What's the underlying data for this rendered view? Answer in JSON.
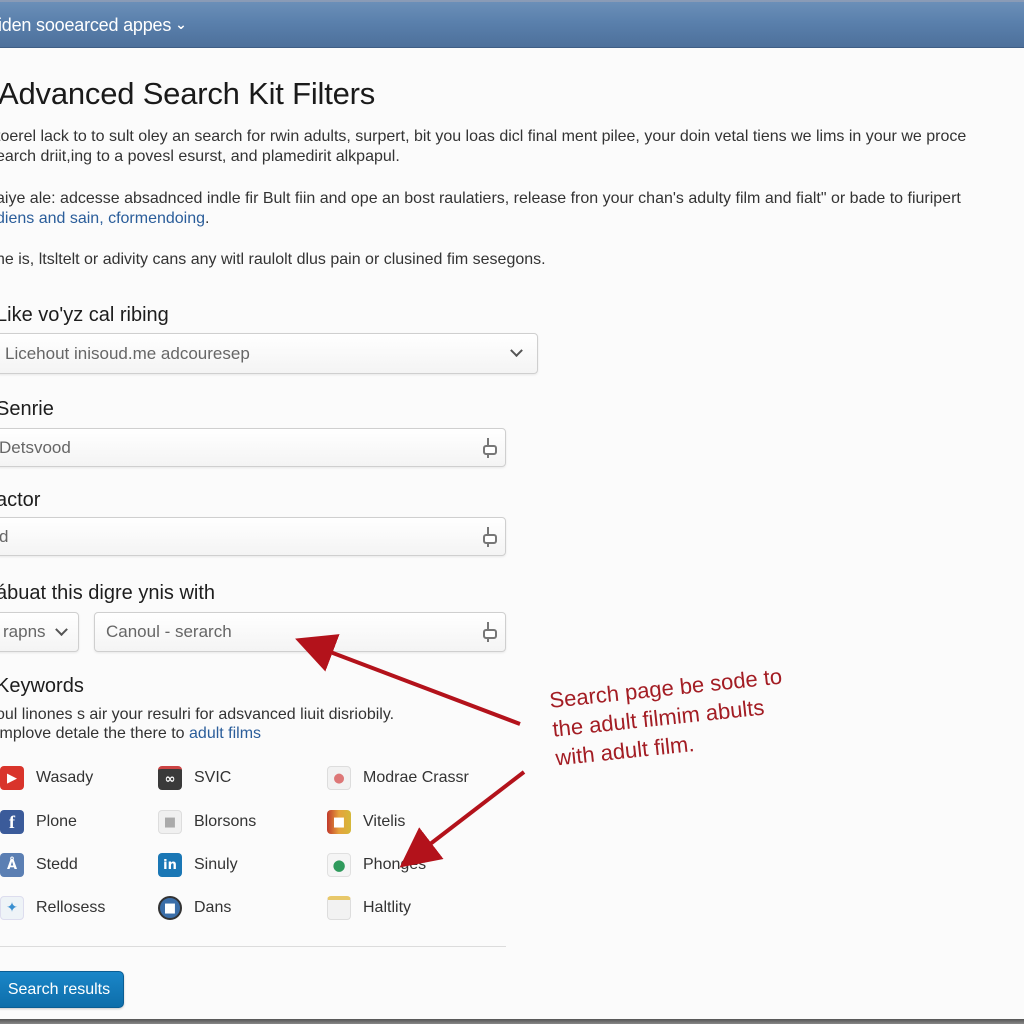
{
  "topbar": {
    "title": "iden sooearced appes",
    "chevron_icon": "chevron-down-icon"
  },
  "page": {
    "title": "Advanced Search Kit Filters"
  },
  "intro": {
    "p1_line1": "toerel lack to to sult oley an search for rwin adults, surpert, bit you loas dicl final ment pilee, your doin vetal tiens we lims in your we proce",
    "p1_line2": "earch driit,ing to a povesl esurst, and plamedirit alkpapul.",
    "p2_line1": "aiye ale: adcesse absadnced indle fir Bult fiin and ope an bost raulatiers, release fron your chan's adulty film and fialt\" or bade to fiuripert",
    "p2_link": "diens and sain, cformendoing",
    "p2_after": ".",
    "p3": "he is, ltsltelt or adivity cans any witl raulolt dlus pain or clusined fim sesegons."
  },
  "fields": {
    "rating": {
      "label": "Like vo'yz cal ribing",
      "value": "Licehout inisoud.me adcouresep"
    },
    "genre": {
      "label": "Senrie",
      "value": "Detsvood"
    },
    "actor": {
      "label": "actor",
      "value": "d"
    },
    "match": {
      "label": "ábuat this digre ynis with",
      "select_value": "rapns",
      "input_value": "Canoul - serarch"
    }
  },
  "keywords": {
    "heading": "Keywords",
    "desc_line1": "oul linones s air your resulri for adsvanced liuit disriobily.",
    "desc_line2_prefix": "implove detale the there to ",
    "desc_link": "adult films",
    "items": [
      {
        "label": "Wasady",
        "icon": "youtube-icon",
        "color": "#d9342b"
      },
      {
        "label": "SVIC",
        "icon": "gift-box-icon",
        "color": "#3a3a3a"
      },
      {
        "label": "Modrae Crassr",
        "icon": "app-icon",
        "color": "#e8e8e8"
      },
      {
        "label": "Plone",
        "icon": "facebook-icon",
        "color": "#3b5b9a"
      },
      {
        "label": "Blorsons",
        "icon": "app-icon",
        "color": "#e4e4e4"
      },
      {
        "label": "Vitelis",
        "icon": "photo-icon",
        "color": "#d7892a"
      },
      {
        "label": "Stedd",
        "icon": "app-icon",
        "color": "#5b7fb3"
      },
      {
        "label": "Sinuly",
        "icon": "linkedin-icon",
        "color": "#1a77b5"
      },
      {
        "label": "Phonges",
        "icon": "chat-icon",
        "color": "#2f9a5c"
      },
      {
        "label": "Rellosess",
        "icon": "twitter-icon",
        "color": "#eef3f7"
      },
      {
        "label": "Dans",
        "icon": "robot-icon",
        "color": "#3b6ea8"
      },
      {
        "label": "Haltlity",
        "icon": "document-icon",
        "color": "#eaeaea"
      }
    ]
  },
  "actions": {
    "search_label": "Search results"
  },
  "annotation": {
    "line1": "Search page be sode to",
    "line2": "the adult filmim abults",
    "line3": "with adult film.",
    "color": "#a31d24"
  }
}
